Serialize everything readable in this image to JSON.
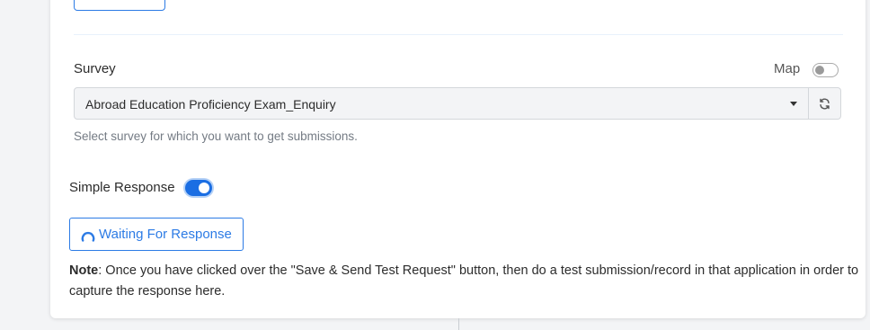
{
  "survey": {
    "label": "Survey",
    "selected": "Abroad Education Proficiency Exam_Enquiry",
    "help_text": "Select survey for which you want to get submissions."
  },
  "map": {
    "label": "Map",
    "enabled": false
  },
  "simple_response": {
    "label": "Simple Response",
    "enabled": true
  },
  "waiting_button": {
    "label": "Waiting For Response"
  },
  "note": {
    "title": "Note",
    "text": ": Once you have clicked over the \"Save & Send Test Request\" button, then do a test submission/record in that application in order to capture the response here."
  },
  "icons": {
    "refresh": "refresh-icon",
    "spinner": "spinner-icon",
    "caret": "chevron-down-icon"
  },
  "colors": {
    "accent": "#2c7be5",
    "toggle_on": "#1b6ee3",
    "muted_text": "#747b84"
  }
}
